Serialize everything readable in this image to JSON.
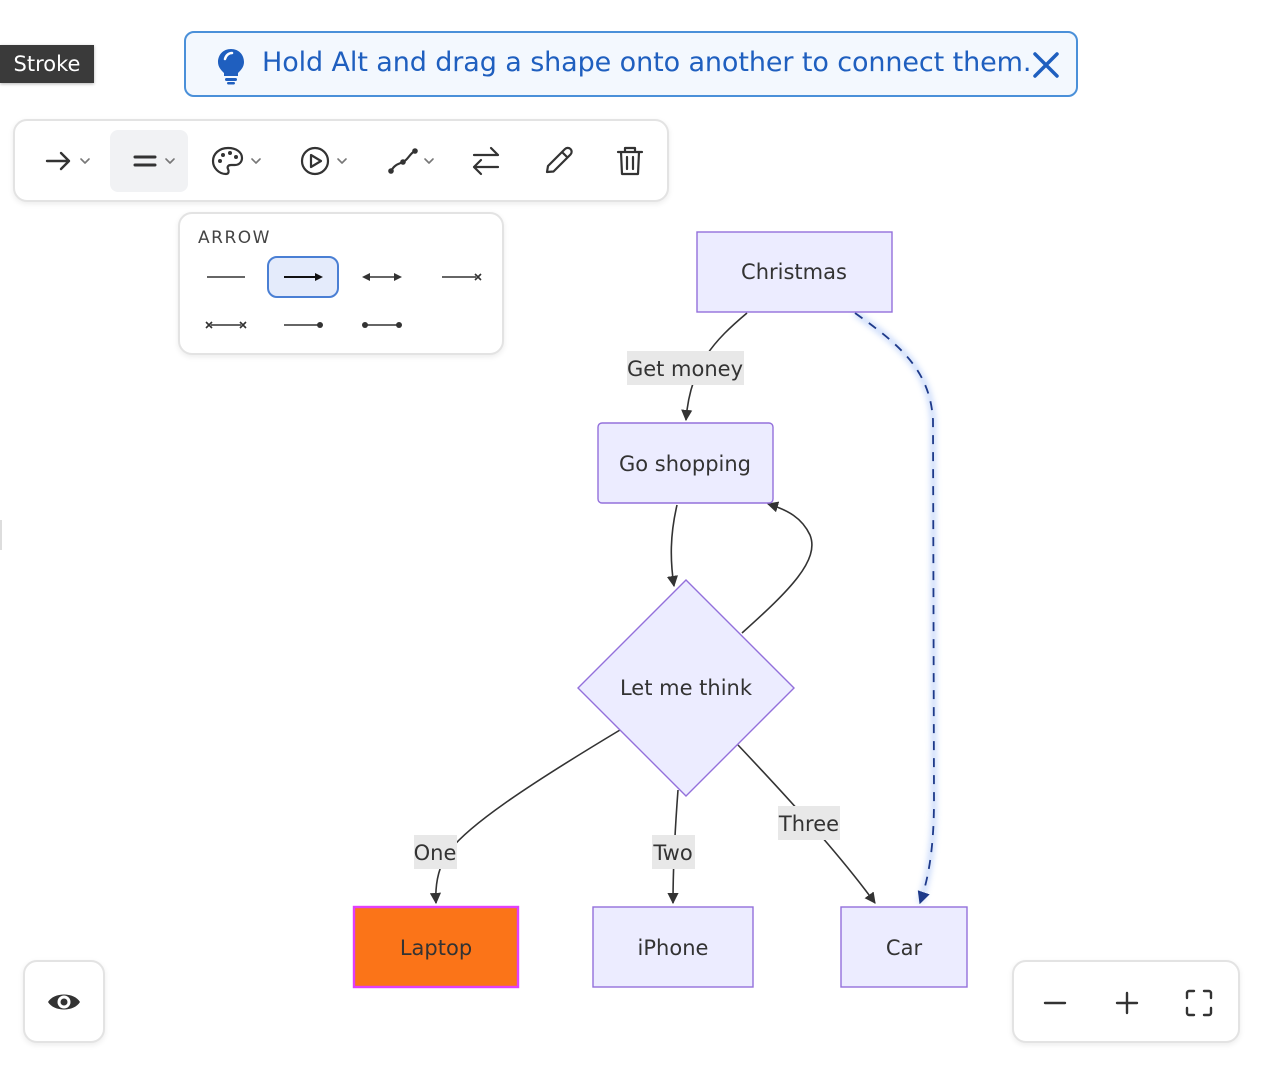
{
  "tooltip": {
    "text": "Stroke"
  },
  "banner": {
    "message": "Hold Alt and drag a shape onto another to connect them.",
    "icon": "lightbulb-icon",
    "close_icon": "close-icon",
    "color": "#1f5fbf"
  },
  "toolbar": {
    "items": [
      {
        "name": "arrow-type",
        "icon": "arrow-right-icon"
      },
      {
        "name": "stroke",
        "icon": "equals-icon",
        "active": true
      },
      {
        "name": "color",
        "icon": "palette-icon"
      },
      {
        "name": "animation",
        "icon": "play-circle-icon"
      },
      {
        "name": "curve",
        "icon": "curve-path-icon"
      },
      {
        "name": "reverse",
        "icon": "swap-arrows-icon"
      },
      {
        "name": "edit",
        "icon": "pencil-icon"
      },
      {
        "name": "delete",
        "icon": "trash-icon"
      }
    ]
  },
  "arrow_popover": {
    "title": "ARROW",
    "options": [
      {
        "name": "line-plain",
        "selected": false
      },
      {
        "name": "arrow-end",
        "selected": true
      },
      {
        "name": "arrow-both",
        "selected": false
      },
      {
        "name": "cross-end",
        "selected": false
      },
      {
        "name": "cross-both",
        "selected": false
      },
      {
        "name": "dot-end",
        "selected": false
      },
      {
        "name": "dot-both",
        "selected": false
      }
    ]
  },
  "diagram": {
    "nodes": {
      "christmas": "Christmas",
      "go_shopping": "Go shopping",
      "let_me_think": "Let me think",
      "laptop": "Laptop",
      "iphone": "iPhone",
      "car": "Car"
    },
    "edge_labels": {
      "get_money": "Get money",
      "one": "One",
      "two": "Two",
      "three": "Three"
    },
    "colors": {
      "node_fill": "#ececff",
      "node_stroke": "#9370db",
      "highlight_fill": "#fb7418",
      "highlight_stroke": "#e040fb",
      "selected_edge": "#1e3a8a"
    }
  },
  "view_toggle": {
    "icon": "eye-icon"
  },
  "zoom": {
    "out_icon": "minus-icon",
    "in_icon": "plus-icon",
    "fit_icon": "fit-screen-icon"
  }
}
